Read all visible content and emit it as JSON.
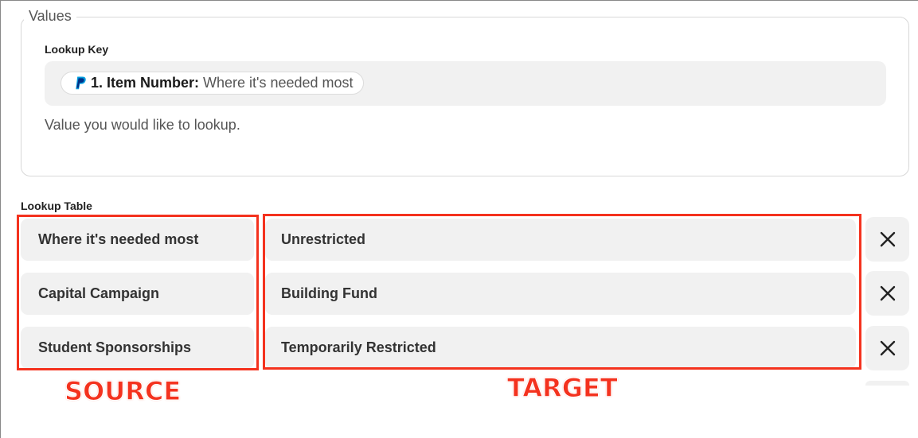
{
  "values_section": {
    "legend": "Values",
    "lookup_key_label": "Lookup Key",
    "pill": {
      "icon": "paypal-icon",
      "label": "1. Item Number:",
      "value": "Where it's needed most"
    },
    "help_text": "Value you would like to lookup."
  },
  "lookup_table": {
    "label": "Lookup Table",
    "rows": [
      {
        "source": "Where it's needed most",
        "target": "Unrestricted"
      },
      {
        "source": "Capital Campaign",
        "target": "Building Fund"
      },
      {
        "source": "Student Sponsorships",
        "target": "Temporarily Restricted"
      }
    ],
    "delete_icon": "close-icon"
  },
  "annotations": {
    "source_label": "SOURCE",
    "target_label": "TARGET",
    "color": "#f4321e"
  },
  "colors": {
    "field_background": "#f1f1f1",
    "paypal_dark": "#003087",
    "paypal_light": "#009cde"
  }
}
